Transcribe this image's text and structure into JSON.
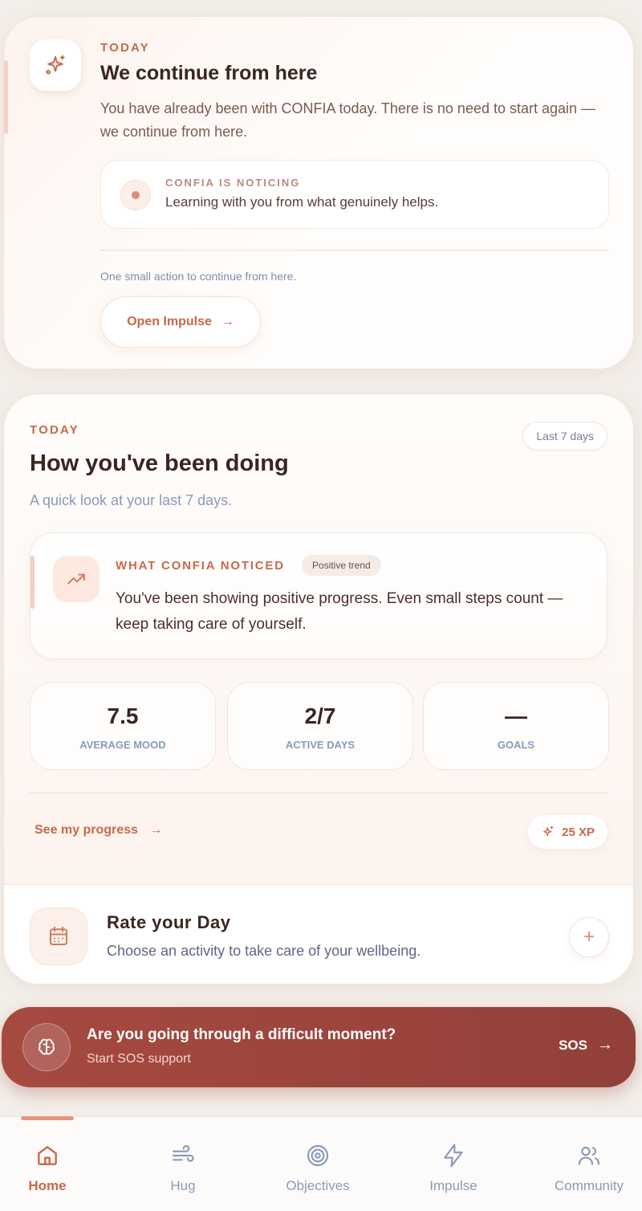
{
  "continue_card": {
    "eyebrow": "TODAY",
    "title": "We continue from here",
    "body": "You have already been with CONFIA today. There is no need to start again — we continue from here.",
    "noticing": {
      "label": "CONFIA IS NOTICING",
      "text": "Learning with you from what genuinely helps."
    },
    "hint": "One small action to continue from here.",
    "action_label": "Open Impulse",
    "action_arrow": "→",
    "icon": "sparkles-icon"
  },
  "summary_card": {
    "eyebrow": "TODAY",
    "title": "How you've been doing",
    "subtitle": "A quick look at your last 7 days.",
    "range_pill": "Last 7 days",
    "noticed": {
      "label": "WHAT CONFIA NOTICED",
      "badge": "Positive trend",
      "text": "You've been showing positive progress. Even small steps count — keep taking care of yourself.",
      "icon": "trending-up-icon"
    },
    "stats": [
      {
        "value": "7.5",
        "label": "AVERAGE MOOD"
      },
      {
        "value": "2/7",
        "label": "ACTIVE DAYS"
      },
      {
        "value": "—",
        "label": "GOALS"
      }
    ],
    "progress_link": "See my progress",
    "progress_arrow": "→",
    "xp": "25 XP"
  },
  "rate_day": {
    "title": "Rate your Day",
    "subtitle": "Choose an activity to take care of your wellbeing.",
    "add_symbol": "+",
    "icon": "calendar-icon"
  },
  "sos": {
    "title": "Are you going through a difficult moment?",
    "subtitle": "Start SOS support",
    "button_label": "SOS",
    "arrow": "→",
    "icon": "brain-icon"
  },
  "nav": {
    "items": [
      {
        "label": "Home",
        "icon": "home-icon",
        "active": true
      },
      {
        "label": "Hug",
        "icon": "wind-icon",
        "active": false
      },
      {
        "label": "Objectives",
        "icon": "target-icon",
        "active": false
      },
      {
        "label": "Impulse",
        "icon": "lightning-icon",
        "active": false
      },
      {
        "label": "Community",
        "icon": "users-icon",
        "active": false
      }
    ]
  },
  "colors": {
    "accent": "#c8684a",
    "sos_bg": "#9c4540",
    "muted_blue": "#8a9abb"
  }
}
